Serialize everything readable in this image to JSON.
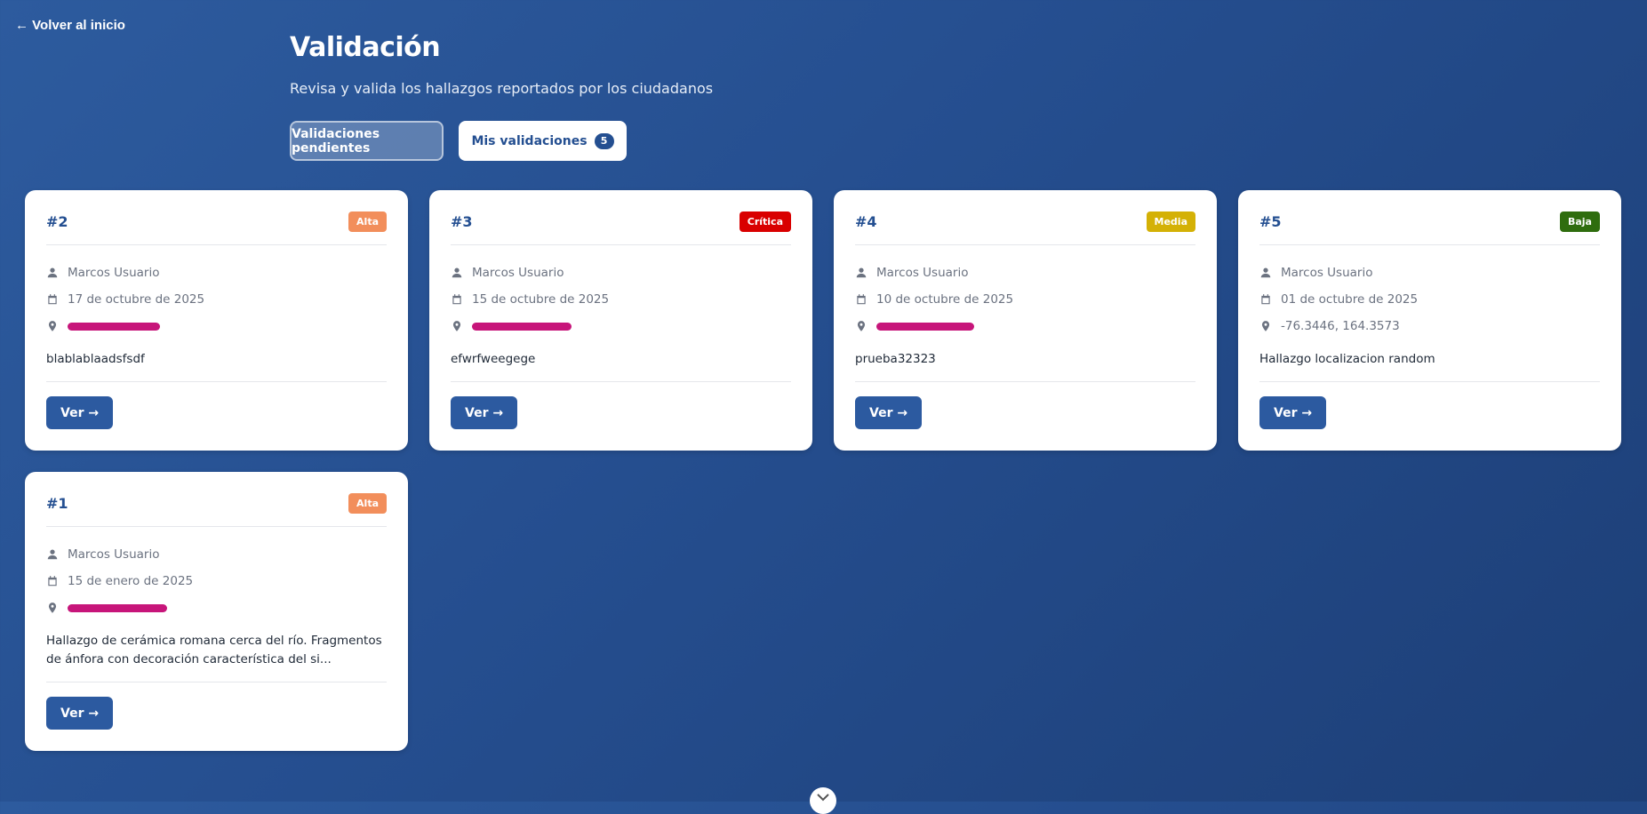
{
  "nav": {
    "back_label": "← Volver al inicio"
  },
  "header": {
    "title": "Validación",
    "subtitle": "Revisa y valida los hallazgos reportados por los ciudadanos"
  },
  "tabs": {
    "pending_label": "Validaciones pendientes",
    "mine_label": "Mis validaciones",
    "mine_count": "5"
  },
  "colors": {
    "alta": "#f28e5b",
    "critica": "#d90000",
    "media": "#d4b106",
    "baja": "#2f6d0e",
    "primary": "#2c5aa0"
  },
  "cards": [
    {
      "id": "#2",
      "priority": "Alta",
      "user": "Marcos Usuario",
      "date": "17 de octubre de 2025",
      "location": "",
      "description": "blablablaadsfsdf",
      "button": "Ver →"
    },
    {
      "id": "#3",
      "priority": "Crítica",
      "user": "Marcos Usuario",
      "date": "15 de octubre de 2025",
      "location": "",
      "description": "efwrfweegege",
      "button": "Ver →"
    },
    {
      "id": "#4",
      "priority": "Media",
      "user": "Marcos Usuario",
      "date": "10 de octubre de 2025",
      "location": "",
      "description": "prueba32323",
      "button": "Ver →"
    },
    {
      "id": "#5",
      "priority": "Baja",
      "user": "Marcos Usuario",
      "date": "01 de octubre de 2025",
      "location": "-76.3446, 164.3573",
      "description": "Hallazgo localizacion random",
      "button": "Ver →"
    },
    {
      "id": "#1",
      "priority": "Alta",
      "user": "Marcos Usuario",
      "date": "15 de enero de 2025",
      "location": "",
      "description": "Hallazgo de cerámica romana cerca del río. Fragmentos de ánfora con decoración característica del si...",
      "button": "Ver →"
    }
  ],
  "icons": {
    "user": "user-icon",
    "date": "calendar-icon",
    "location": "location-pin-icon",
    "scroll": "chevron-down-icon"
  }
}
